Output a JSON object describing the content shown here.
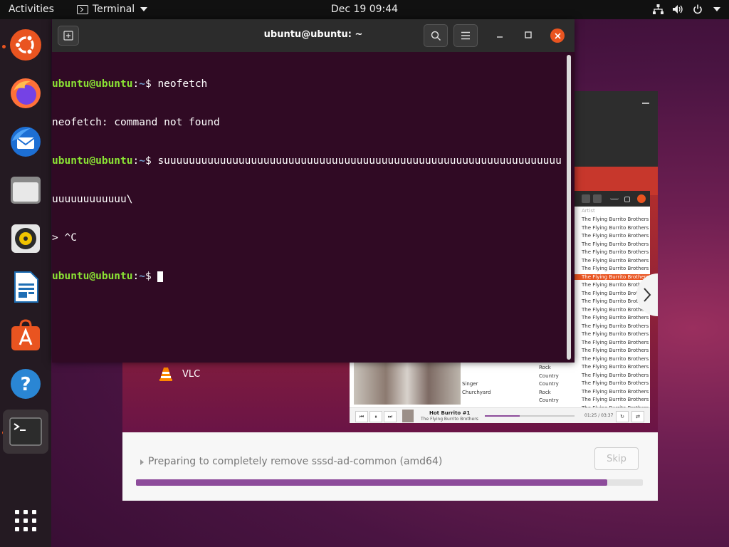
{
  "topbar": {
    "activities": "Activities",
    "app_name": "Terminal",
    "clock": "Dec 19  09:44"
  },
  "dock": {
    "items": [
      "ubuntu-installer",
      "firefox",
      "thunderbird",
      "files",
      "rhythmbox",
      "libreoffice-writer",
      "ubuntu-software",
      "help",
      "terminal"
    ],
    "apps_grid_icon": "show-applications-icon"
  },
  "terminal": {
    "title": "ubuntu@ubuntu: ~",
    "prompt_user": "ubuntu@ubuntu",
    "prompt_sep": ":",
    "prompt_path": "~",
    "prompt_sym": "$ ",
    "lines": {
      "l1_cmd": "neofetch",
      "l2": "neofetch: command not found",
      "l3_cmd": "suuuuuuuuuuuuuuuuuuuuuuuuuuuuuuuuuuuuuuuuuuuuuuuuuuuuuuuuuuuuuuuu",
      "l4": "uuuuuuuuuuuu\\",
      "l5": "> ^C"
    }
  },
  "installer": {
    "vlc_label": "VLC",
    "status": "Preparing to completely remove sssd-ad-common (amd64)",
    "skip_label": "Skip",
    "progress": 0.93
  },
  "rhythmbox": {
    "artist_header": "Artist",
    "artist_name": "The Flying Burrito Brothers",
    "artist_rows": 24,
    "selected_row_index": 7,
    "mid_labels": [
      "Singer",
      "Churchyard"
    ],
    "genres": [
      "Rock",
      "Country",
      "Country",
      "Rock",
      "Country"
    ],
    "track_title": "Hot Burrito #1",
    "track_artist": "The Flying Burrito Brothers",
    "time": "01:25 / 03:37",
    "seek_progress": 0.39
  }
}
